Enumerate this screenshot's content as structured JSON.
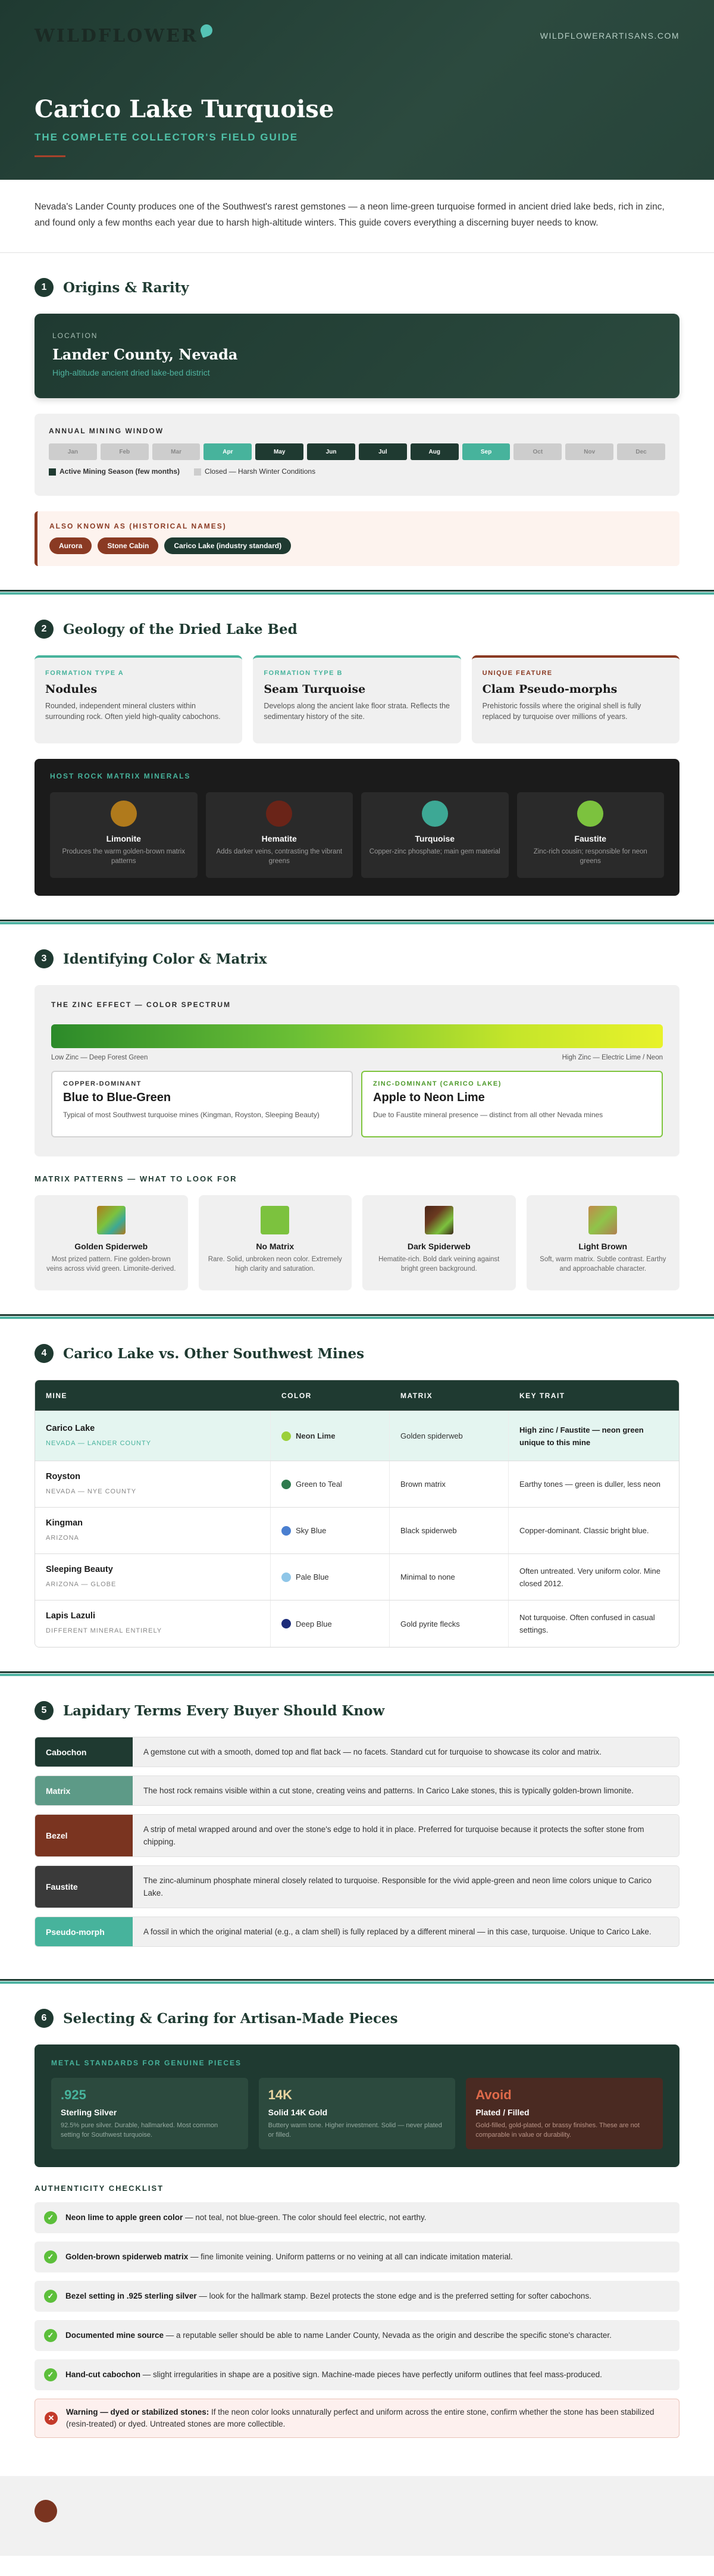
{
  "brand": {
    "logo_text": "WILDFLOWER",
    "site_url": "WILDFLOWERARTISANS.COM"
  },
  "hero": {
    "title": "Carico Lake Turquoise",
    "subtitle": "THE COMPLETE COLLECTOR'S FIELD GUIDE"
  },
  "intro": "Nevada's Lander County produces one of the Southwest's rarest gemstones — a neon lime-green turquoise formed in ancient dried lake beds, rich in zinc, and found only a few months each year due to harsh high-altitude winters. This guide covers everything a discerning buyer needs to know.",
  "s1": {
    "num": "1",
    "title": "Origins & Rarity",
    "location_label": "LOCATION",
    "location": "Lander County, Nevada",
    "location_desc": "High-altitude ancient dried lake-bed district",
    "mining_label": "ANNUAL MINING WINDOW",
    "months": [
      {
        "m": "Jan",
        "s": "off"
      },
      {
        "m": "Feb",
        "s": "off"
      },
      {
        "m": "Mar",
        "s": "off"
      },
      {
        "m": "Apr",
        "s": "peak"
      },
      {
        "m": "May",
        "s": "on"
      },
      {
        "m": "Jun",
        "s": "on"
      },
      {
        "m": "Jul",
        "s": "on"
      },
      {
        "m": "Aug",
        "s": "on"
      },
      {
        "m": "Sep",
        "s": "peak"
      },
      {
        "m": "Oct",
        "s": "off"
      },
      {
        "m": "Nov",
        "s": "off"
      },
      {
        "m": "Dec",
        "s": "off"
      }
    ],
    "legend_active": "Active Mining Season (few months)",
    "legend_closed": "Closed — Harsh Winter Conditions",
    "aka_label": "ALSO KNOWN AS (HISTORICAL NAMES)",
    "aka": [
      "Aurora",
      "Stone Cabin",
      "Carico Lake (industry standard)"
    ]
  },
  "s2": {
    "num": "2",
    "title": "Geology of the Dried Lake Bed",
    "formations": [
      {
        "tag": "FORMATION TYPE A",
        "name": "Nodules",
        "desc": "Rounded, independent mineral clusters within surrounding rock. Often yield high-quality cabochons."
      },
      {
        "tag": "FORMATION TYPE B",
        "name": "Seam Turquoise",
        "desc": "Develops along the ancient lake floor strata. Reflects the sedimentary history of the site."
      },
      {
        "tag": "UNIQUE FEATURE",
        "name": "Clam Pseudo-morphs",
        "desc": "Prehistoric fossils where the original shell is fully replaced by turquoise over millions of years."
      }
    ],
    "minerals_label": "HOST ROCK MATRIX MINERALS",
    "minerals": [
      {
        "name": "Limonite",
        "desc": "Produces the warm golden-brown matrix patterns",
        "color": "#b07a1c"
      },
      {
        "name": "Hematite",
        "desc": "Adds darker veins, contrasting the vibrant greens",
        "color": "#6a2418"
      },
      {
        "name": "Turquoise",
        "desc": "Copper-zinc phosphate; main gem material",
        "color": "#3da895"
      },
      {
        "name": "Faustite",
        "desc": "Zinc-rich cousin; responsible for neon greens",
        "color": "#7cc23e"
      }
    ]
  },
  "s3": {
    "num": "3",
    "title": "Identifying Color & Matrix",
    "zinc_label": "THE ZINC EFFECT — COLOR SPECTRUM",
    "zinc_low": "Low Zinc — Deep Forest Green",
    "zinc_high": "High Zinc — Electric Lime / Neon",
    "copper_tag": "COPPER-DOMINANT",
    "copper_name": "Blue to Blue-Green",
    "copper_desc": "Typical of most Southwest turquoise mines (Kingman, Royston, Sleeping Beauty)",
    "zinc_tag": "ZINC-DOMINANT (CARICO LAKE)",
    "zinc_name": "Apple to Neon Lime",
    "zinc_desc": "Due to Faustite mineral presence — distinct from all other Nevada mines",
    "matrix_label": "MATRIX PATTERNS — WHAT TO LOOK FOR",
    "patterns": [
      {
        "name": "Golden Spiderweb",
        "desc": "Most prized pattern. Fine golden-brown veins across vivid green. Limonite-derived."
      },
      {
        "name": "No Matrix",
        "desc": "Rare. Solid, unbroken neon color. Extremely high clarity and saturation."
      },
      {
        "name": "Dark Spiderweb",
        "desc": "Hematite-rich. Bold dark veining against bright green background."
      },
      {
        "name": "Light Brown",
        "desc": "Soft, warm matrix. Subtle contrast. Earthy and approachable character."
      }
    ]
  },
  "s4": {
    "num": "4",
    "title": "Carico Lake vs. Other Southwest Mines",
    "headers": [
      "MINE",
      "COLOR",
      "MATRIX",
      "KEY TRAIT"
    ],
    "rows": [
      {
        "mine": "Carico Lake",
        "loc": "NEVADA — LANDER COUNTY",
        "color": "Neon Lime",
        "dot": "#9bd03a",
        "matrix": "Golden spiderweb",
        "trait": "High zinc / Faustite — neon green unique to this mine"
      },
      {
        "mine": "Royston",
        "loc": "NEVADA — NYE COUNTY",
        "color": "Green to Teal",
        "dot": "#2f7a4e",
        "matrix": "Brown matrix",
        "trait": "Earthy tones — green is duller, less neon"
      },
      {
        "mine": "Kingman",
        "loc": "ARIZONA",
        "color": "Sky Blue",
        "dot": "#4a7fd0",
        "matrix": "Black spiderweb",
        "trait": "Copper-dominant. Classic bright blue."
      },
      {
        "mine": "Sleeping Beauty",
        "loc": "ARIZONA — GLOBE",
        "color": "Pale Blue",
        "dot": "#8fc6e8",
        "matrix": "Minimal to none",
        "trait": "Often untreated. Very uniform color. Mine closed 2012."
      },
      {
        "mine": "Lapis Lazuli",
        "loc": "DIFFERENT MINERAL ENTIRELY",
        "color": "Deep Blue",
        "dot": "#1d2d7a",
        "matrix": "Gold pyrite flecks",
        "trait": "Not turquoise. Often confused in casual settings."
      }
    ]
  },
  "s5": {
    "num": "5",
    "title": "Lapidary Terms Every Buyer Should Know",
    "terms": [
      {
        "k": "Cabochon",
        "v": "A gemstone cut with a smooth, domed top and flat back — no facets. Standard cut for turquoise to showcase its color and matrix.",
        "color": "#1f3a31"
      },
      {
        "k": "Matrix",
        "v": "The host rock remains visible within a cut stone, creating veins and patterns. In Carico Lake stones, this is typically golden-brown limonite.",
        "color": "#5d9a87"
      },
      {
        "k": "Bezel",
        "v": "A strip of metal wrapped around and over the stone's edge to hold it in place. Preferred for turquoise because it protects the softer stone from chipping.",
        "color": "#7a3420"
      },
      {
        "k": "Faustite",
        "v": "The zinc-aluminum phosphate mineral closely related to turquoise. Responsible for the vivid apple-green and neon lime colors unique to Carico Lake.",
        "color": "#3a3a3a"
      },
      {
        "k": "Pseudo-morph",
        "v": "A fossil in which the original material (e.g., a clam shell) is fully replaced by a different mineral — in this case, turquoise. Unique to Carico Lake.",
        "color": "#47b39c"
      }
    ]
  },
  "s6": {
    "num": "6",
    "title": "Selecting & Caring for Artisan-Made Pieces",
    "metals_label": "METAL STANDARDS FOR GENUINE PIECES",
    "metals": [
      {
        "title": ".925",
        "name": "Sterling Silver",
        "desc": "92.5% pure silver. Durable, hallmarked. Most common setting for Southwest turquoise."
      },
      {
        "title": "14K",
        "name": "Solid 14K Gold",
        "desc": "Buttery warm tone. Higher investment. Solid — never plated or filled."
      },
      {
        "title": "Avoid",
        "name": "Plated / Filled",
        "desc": "Gold-filled, gold-plated, or brassy finishes. These are not comparable in value or durability."
      }
    ],
    "checklist_label": "AUTHENTICITY CHECKLIST",
    "checks": [
      {
        "b": "Neon lime to apple green color",
        "t": " — not teal, not blue-green. The color should feel electric, not earthy."
      },
      {
        "b": "Golden-brown spiderweb matrix",
        "t": " — fine limonite veining. Uniform patterns or no veining at all can indicate imitation material."
      },
      {
        "b": "Bezel setting in .925 sterling silver",
        "t": " — look for the hallmark stamp. Bezel protects the stone edge and is the preferred setting for softer cabochons."
      },
      {
        "b": "Documented mine source",
        "t": " — a reputable seller should be able to name Lander County, Nevada as the origin and describe the specific stone's character."
      },
      {
        "b": "Hand-cut cabochon",
        "t": " — slight irregularities in shape are a positive sign. Machine-made pieces have perfectly uniform outlines that feel mass-produced."
      }
    ],
    "warning_b": "Warning — dyed or stabilized stones:",
    "warning_t": " If the neon color looks unnaturally perfect and uniform across the entire stone, confirm whether the stone has been stabilized (resin-treated) or dyed. Untreated stones are more collectible."
  },
  "colors": {
    "forest": "#1f3a31",
    "teal": "#47b39c",
    "rust": "#8a3a23"
  }
}
